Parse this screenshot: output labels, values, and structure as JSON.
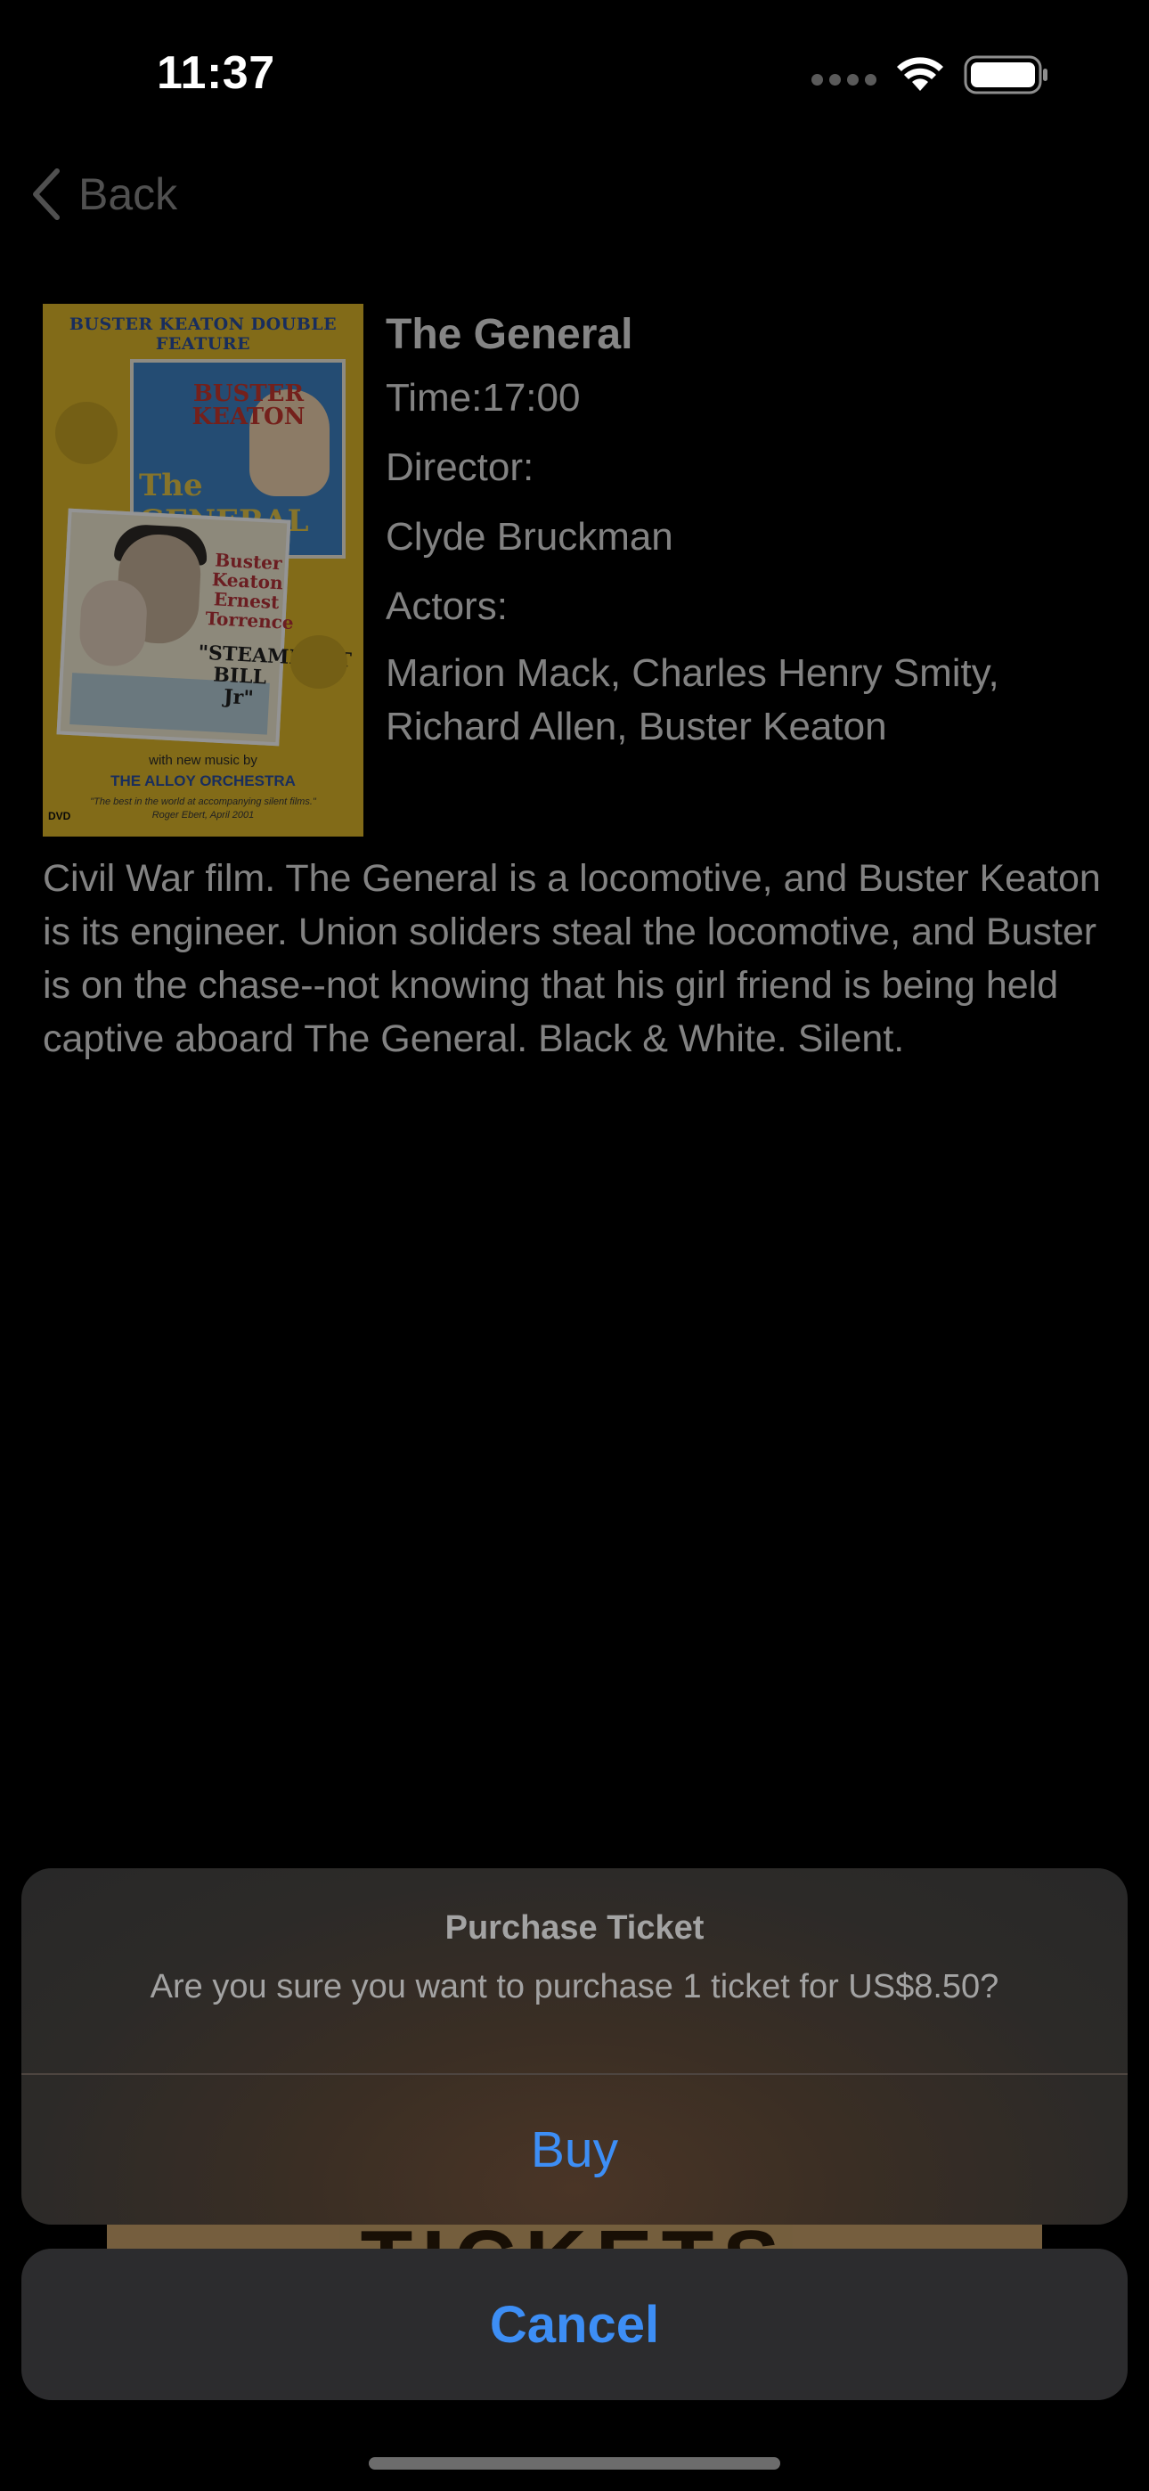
{
  "status_bar": {
    "time": "11:37"
  },
  "nav": {
    "back_label": "Back"
  },
  "poster": {
    "header": "BUSTER KEATON DOUBLE FEATURE",
    "card1_name": "BUSTER KEATON",
    "card1_title": "The GENERAL",
    "card2_credits": "Buster Keaton Ernest Torrence",
    "card2_title": "\"STEAMBOAT BILL Jr\"",
    "music_line": "with new music by",
    "orchestra": "THE ALLOY ORCHESTRA",
    "quote": "\"The best in the world at accompanying silent films.\" Roger Ebert, April 2001",
    "format": "DVD"
  },
  "movie": {
    "title": "The General",
    "time": "Time:17:00",
    "director_label": "Director:",
    "director": "Clyde Bruckman",
    "actors_label": "Actors:",
    "actors": "Marion Mack, Charles Henry Smity, Richard Allen, Buster Keaton",
    "synopsis": "Civil War film. The General is a locomotive, and Buster Keaton is its engineer. Union soliders steal the locomotive, and Buster is on the chase--not knowing that his girl friend is being held captive aboard The General. Black & White. Silent."
  },
  "background_banner": {
    "text": "TICKETS"
  },
  "action_sheet": {
    "title": "Purchase Ticket",
    "message": "Are you sure you want to purchase 1 ticket for US$8.50?",
    "buy_label": "Buy",
    "cancel_label": "Cancel"
  },
  "colors": {
    "accent": "#3d8ef5",
    "background": "#000000",
    "sheet": "#2c2c2e"
  }
}
